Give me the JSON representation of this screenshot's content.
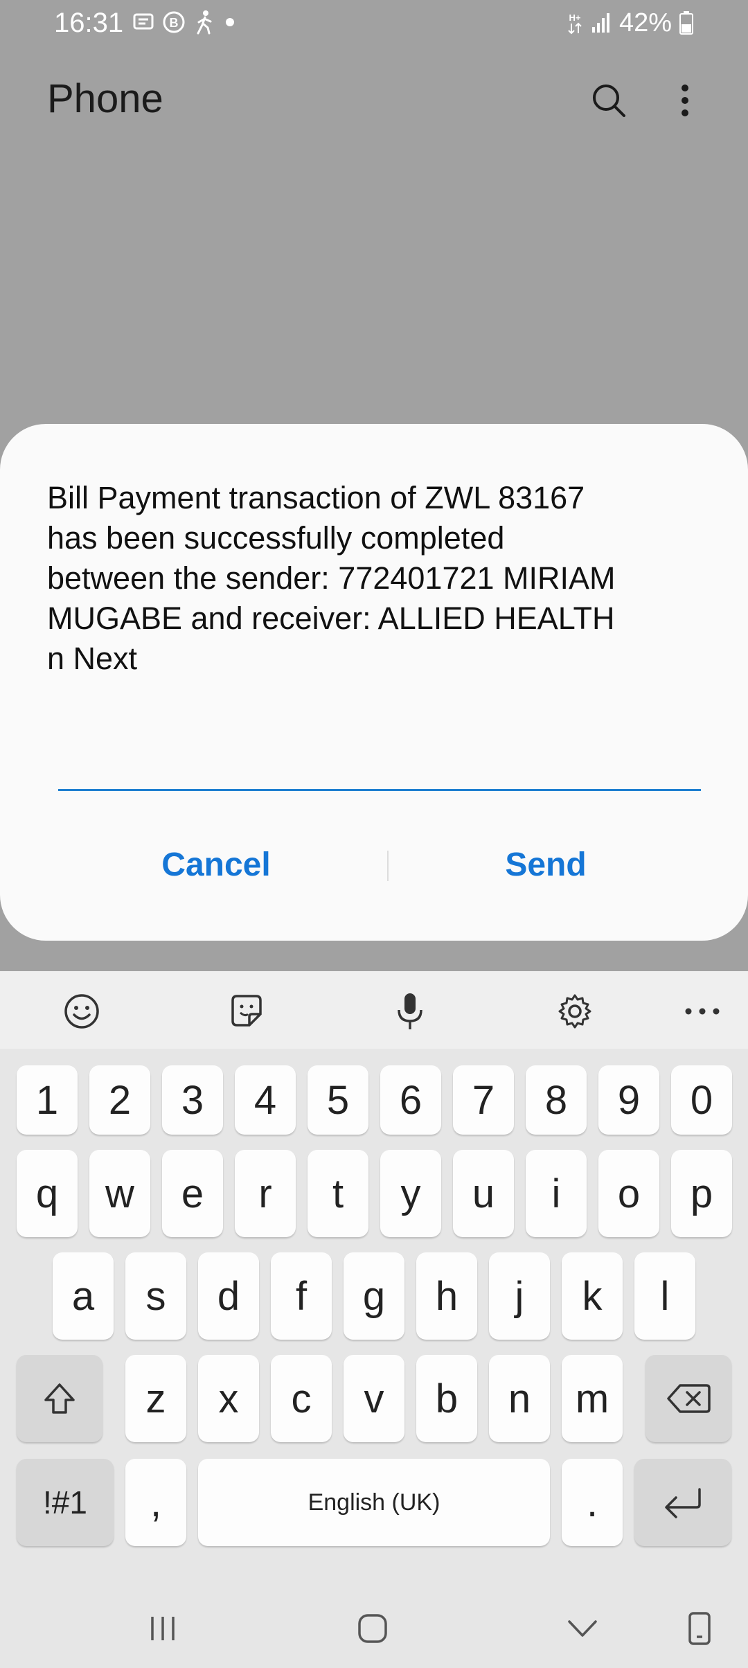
{
  "status_bar": {
    "time": "16:31",
    "battery_percent": "42%",
    "icons_left": [
      "message-icon",
      "b-circle-icon",
      "walking-icon",
      "dot-icon"
    ],
    "icons_right": [
      "data-arrows-icon",
      "signal-icon",
      "battery-icon"
    ]
  },
  "app_bar": {
    "title": "Phone",
    "icons": [
      "search-icon",
      "more-vert-icon"
    ]
  },
  "dialog": {
    "message": "Bill Payment transaction of ZWL 83167\nhas been successfully completed\nbetween the sender: 772401721 MIRIAM\nMUGABE and receiver: ALLIED HEALTH\nn Next",
    "input_value": "",
    "cancel_label": "Cancel",
    "send_label": "Send"
  },
  "keyboard": {
    "toolbar_icons": [
      "emoji-icon",
      "sticker-icon",
      "microphone-icon",
      "settings-icon",
      "more-horiz-icon"
    ],
    "row_numbers": [
      "1",
      "2",
      "3",
      "4",
      "5",
      "6",
      "7",
      "8",
      "9",
      "0"
    ],
    "row_q": [
      "q",
      "w",
      "e",
      "r",
      "t",
      "y",
      "u",
      "i",
      "o",
      "p"
    ],
    "row_a": [
      "a",
      "s",
      "d",
      "f",
      "g",
      "h",
      "j",
      "k",
      "l"
    ],
    "row_z": [
      "z",
      "x",
      "c",
      "v",
      "b",
      "n",
      "m"
    ],
    "symbols_label": "!#1",
    "comma_label": ",",
    "space_label": "English (UK)",
    "period_label": ".",
    "shift_icon": "shift-icon",
    "backspace_icon": "backspace-icon",
    "enter_icon": "enter-icon"
  },
  "nav_bar": {
    "icons": [
      "recents-icon",
      "home-icon",
      "hide-keyboard-icon",
      "keyboard-switch-icon"
    ]
  },
  "colors": {
    "scrim": "#a1a1a1",
    "dialog_bg": "#fafafa",
    "accent": "#1576d6",
    "keyboard_bg": "#e6e6e6"
  }
}
